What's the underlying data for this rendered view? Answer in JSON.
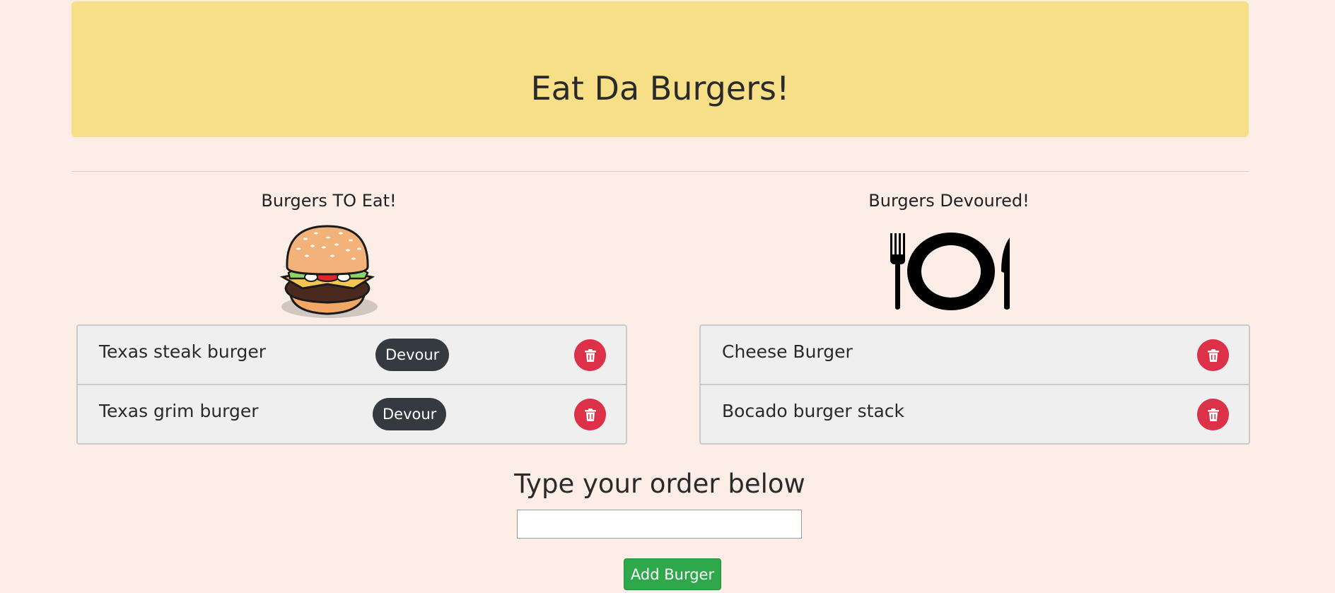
{
  "header": {
    "title": "Eat Da Burgers!"
  },
  "to_eat": {
    "title": "Burgers TO Eat!",
    "items": [
      {
        "name": "Texas steak burger",
        "action_label": "Devour"
      },
      {
        "name": "Texas grim burger",
        "action_label": "Devour"
      }
    ]
  },
  "devoured": {
    "title": "Burgers Devoured!",
    "items": [
      {
        "name": "Cheese Burger"
      },
      {
        "name": "Bocado burger stack"
      }
    ]
  },
  "order_form": {
    "title": "Type your order below",
    "input_value": "",
    "submit_label": "Add Burger"
  },
  "colors": {
    "background": "#fcede6",
    "jumbotron": "#f7df88",
    "devour_button": "#353a40",
    "delete_button": "#dc3148",
    "add_button": "#2ea84a"
  }
}
